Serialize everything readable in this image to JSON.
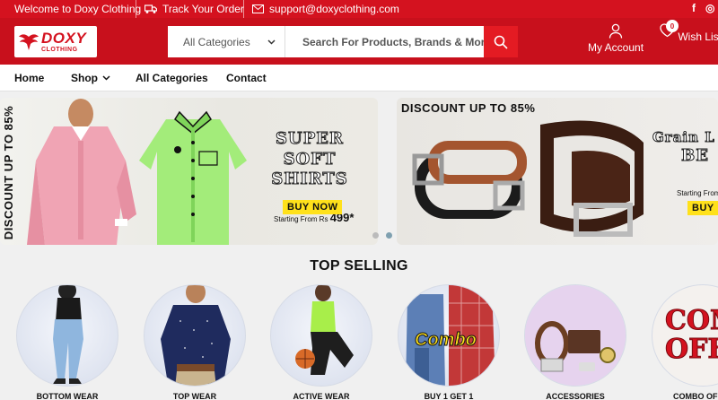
{
  "topbar": {
    "welcome": "Welcome to Doxy Clothing",
    "track": "Track Your Order",
    "email": "support@doxyclothing.com",
    "social": [
      "f",
      "◎"
    ]
  },
  "header": {
    "logo_main": "DOXY",
    "logo_sub": "CLOTHING",
    "category_select": "All Categories",
    "search_placeholder": "Search For Products, Brands & More..",
    "account_label": "My Account",
    "wishlist_label": "Wish List",
    "wishlist_count": "0"
  },
  "nav": {
    "home": "Home",
    "shop": "Shop",
    "all_categories": "All Categories",
    "contact": "Contact"
  },
  "banners": [
    {
      "side_text": "DISCOUNT UP TO 85%",
      "title_line1": "SUPER SOFT",
      "title_line2": "SHIRTS",
      "starting_prefix": "Starting From Rs",
      "price": "499*",
      "cta": "BUY NOW"
    },
    {
      "top_text": "DISCOUNT UP TO 85%",
      "title_line1": "Grain L",
      "title_line2": "BE",
      "starting_prefix": "Starting From",
      "cta": "BUY"
    }
  ],
  "carousel": {
    "slides": 2,
    "active": 1
  },
  "top_selling": {
    "title": "TOP SELLING",
    "categories": [
      {
        "label": "BOTTOM WEAR"
      },
      {
        "label": "TOP WEAR"
      },
      {
        "label": "ACTIVE WEAR"
      },
      {
        "label": "BUY 1 GET 1",
        "overlay": "Combo"
      },
      {
        "label": "ACCESSORIES"
      },
      {
        "label": "COMBO OFF",
        "overlay_line1": "COMB",
        "overlay_line2": "OFFE"
      }
    ]
  },
  "colors": {
    "brand_red": "#d4121f",
    "cta_yellow": "#ffe11b"
  }
}
